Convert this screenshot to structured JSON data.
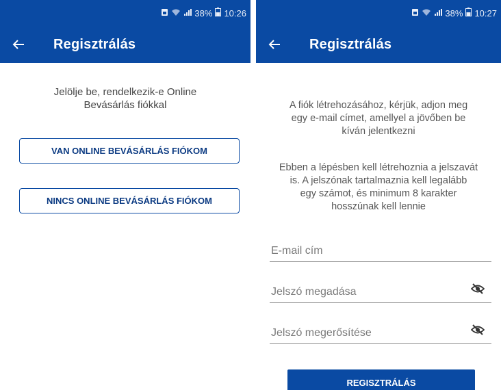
{
  "colors": {
    "primary": "#0a4aa3",
    "button_text": "#0b3a82",
    "text": "#444444"
  },
  "left_screen": {
    "status": {
      "battery": "38%",
      "time": "10:26"
    },
    "appbar": {
      "title": "Regisztrálás"
    },
    "prompt_line1": "Jelölje be, rendelkezik-e Online",
    "prompt_line2": "Bevásárlás fiókkal",
    "have_account_button": "VAN ONLINE BEVÁSÁRLÁS FIÓKOM",
    "no_account_button": "NINCS ONLINE BEVÁSÁRLÁS FIÓKOM"
  },
  "right_screen": {
    "status": {
      "battery": "38%",
      "time": "10:27"
    },
    "appbar": {
      "title": "Regisztrálás"
    },
    "info_line1": "A fiók létrehozásához, kérjük, adjon meg",
    "info_line2": "egy e-mail címet, amellyel a jövőben be",
    "info_line3": "kíván jelentkezni",
    "password_info_line1": "Ebben a lépésben kell létrehoznia a jelszavát",
    "password_info_line2": "is. A jelszónak tartalmaznia kell legalább",
    "password_info_line3": "egy számot, és minimum 8 karakter",
    "password_info_line4": "hosszúnak kell lennie",
    "email_placeholder": "E-mail cím",
    "password_placeholder": "Jelszó megadása",
    "confirm_placeholder": "Jelszó megerősítése",
    "register_button": "REGISZTRÁLÁS"
  }
}
